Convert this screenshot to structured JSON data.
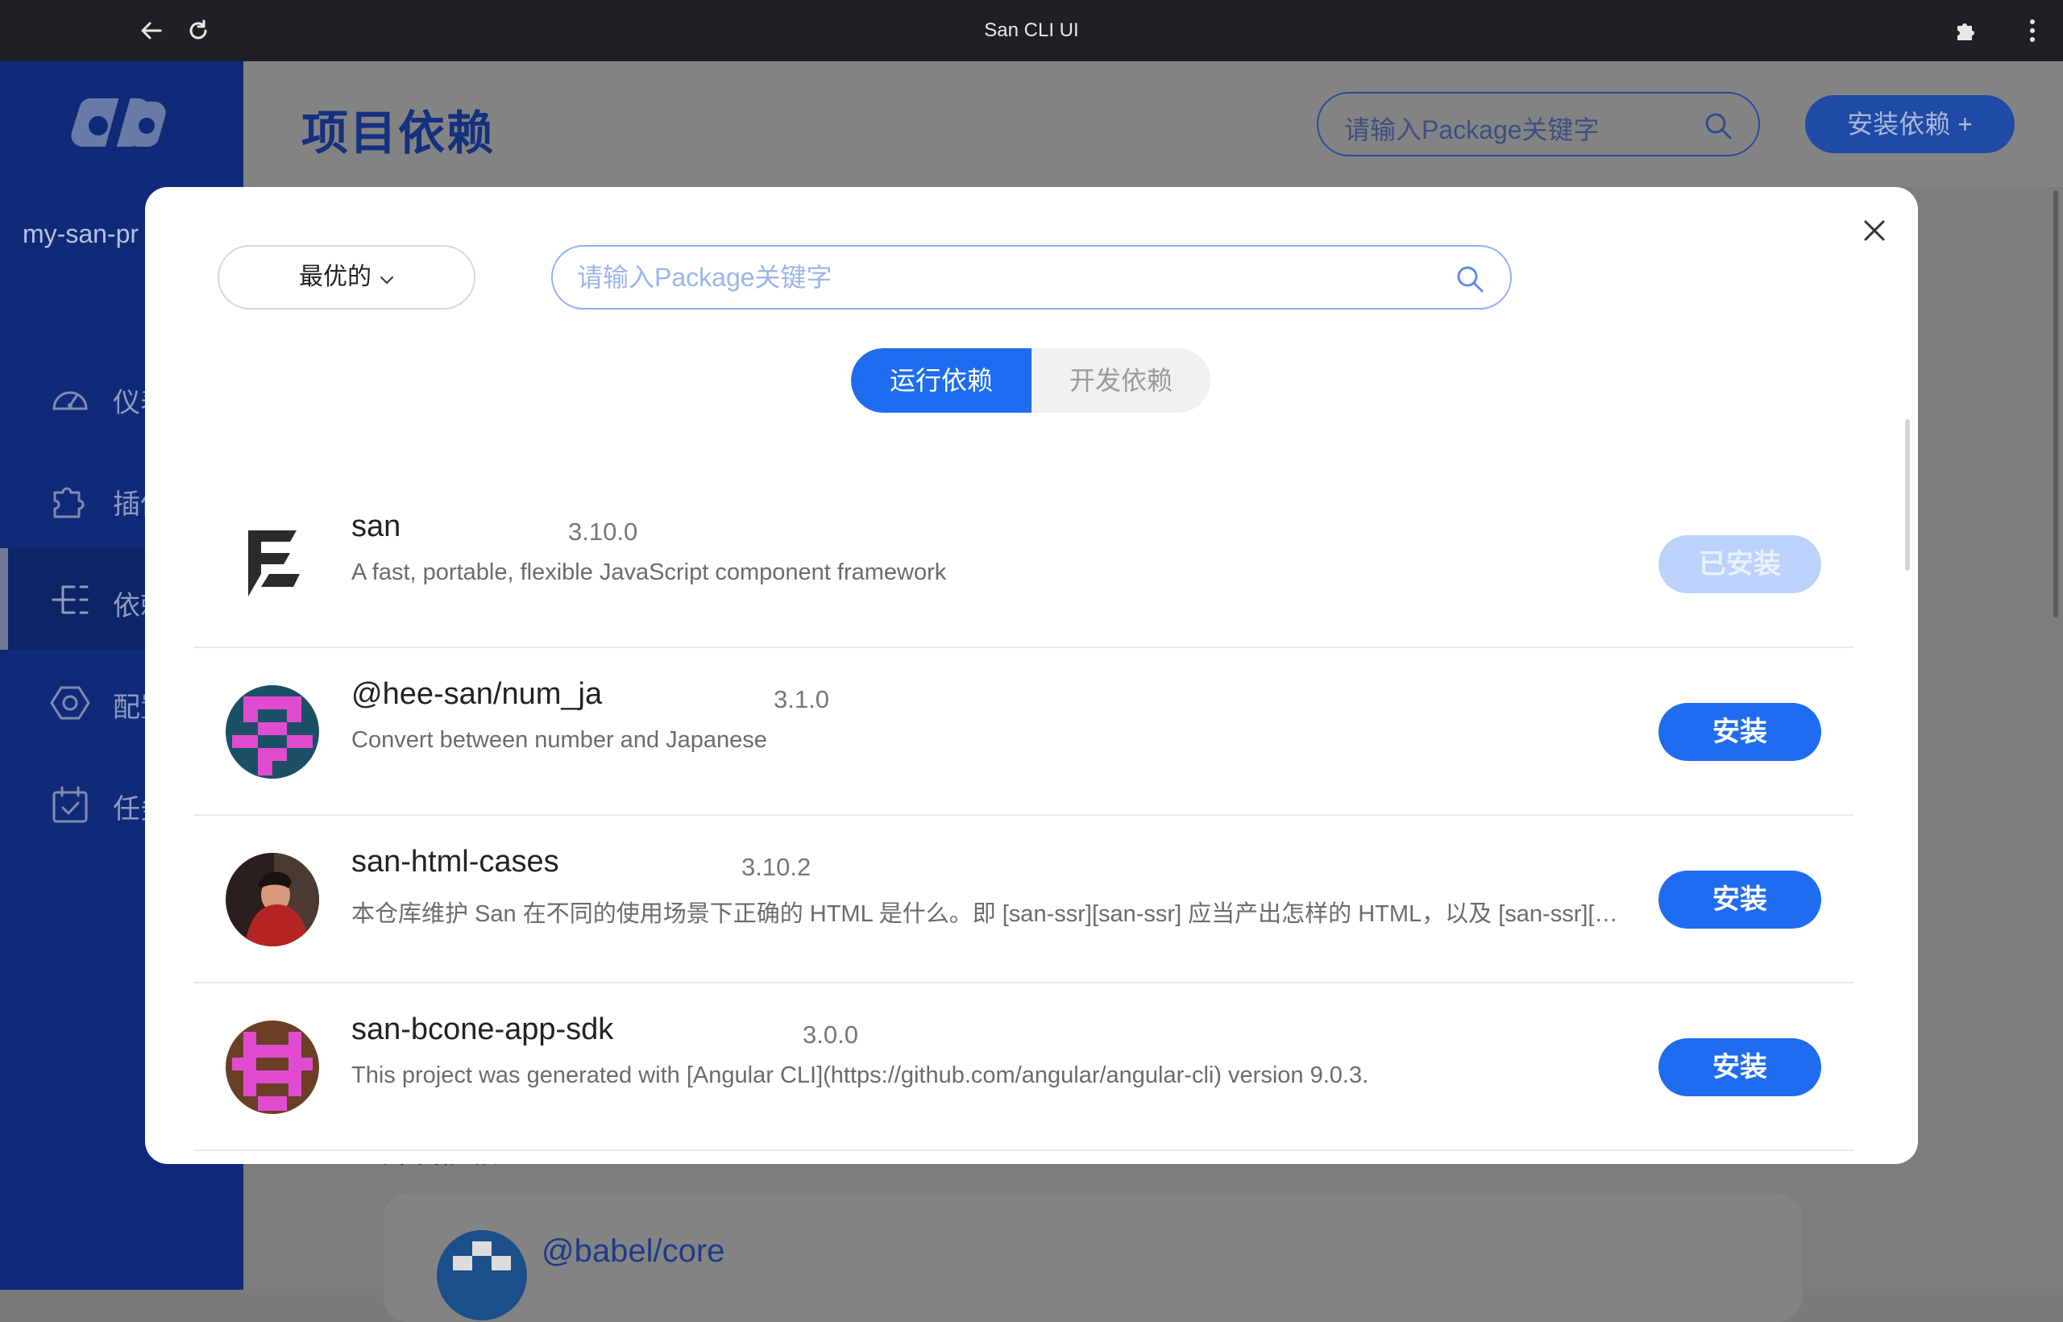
{
  "browser": {
    "title": "San CLI UI",
    "icons": [
      "back-arrow-icon",
      "reload-icon",
      "puzzle-icon",
      "kebab-menu-icon"
    ]
  },
  "sidebar": {
    "project_name": "my-san-pr",
    "items": [
      {
        "label": "仪表",
        "icon": "dashboard-icon",
        "active": false
      },
      {
        "label": "插件",
        "icon": "plugin-icon",
        "active": false
      },
      {
        "label": "依赖",
        "icon": "dependency-icon",
        "active": true
      },
      {
        "label": "配置",
        "icon": "config-icon",
        "active": false
      },
      {
        "label": "任务",
        "icon": "task-icon",
        "active": false
      }
    ]
  },
  "page": {
    "title": "项目依赖",
    "search_placeholder": "请输入Package关键字",
    "install_button": "安装依赖 +",
    "section_label": "开发依赖",
    "bg_package": "@babel/core"
  },
  "modal": {
    "sort_label": "最优的",
    "search_placeholder": "请输入Package关键字",
    "search_value": "",
    "tabs": [
      {
        "label": "运行依赖",
        "active": true
      },
      {
        "label": "开发依赖",
        "active": false
      }
    ],
    "packages": [
      {
        "name": "san",
        "version": "3.10.0",
        "description": "A fast, portable, flexible JavaScript component framework",
        "button": "已安装",
        "installed": true
      },
      {
        "name": "@hee-san/num_ja",
        "version": "3.1.0",
        "description": "Convert between number and Japanese",
        "button": "安装",
        "installed": false
      },
      {
        "name": "san-html-cases",
        "version": "3.10.2",
        "description": "本仓库维护 San 在不同的使用场景下正确的 HTML 是什么。即 [san-ssr][san-ssr] 应当产出怎样的 HTML，以及 [san-ssr][san-ssr] 的输出是否符合预期",
        "button": "安装",
        "installed": false
      },
      {
        "name": "san-bcone-app-sdk",
        "version": "3.0.0",
        "description": "This project was generated with [Angular CLI](https://github.com/angular/angular-cli) version 9.0.3.",
        "button": "安装",
        "installed": false
      }
    ]
  },
  "colors": {
    "primary": "#1f6cf0",
    "sidebar": "#102a7a",
    "installed_btn": "#bcd2fb"
  }
}
